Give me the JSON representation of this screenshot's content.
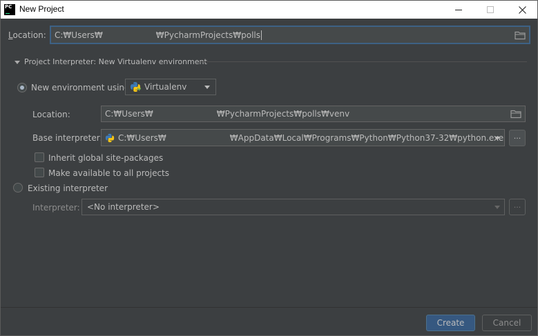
{
  "window": {
    "title": "New Project",
    "app_icon_text": "PC"
  },
  "location": {
    "label_prefix": "",
    "label_mnemonic": "L",
    "label_rest": "ocation:",
    "value_start": "C:₩Users₩",
    "value_end": "₩PycharmProjects₩polls"
  },
  "interpreter_section": {
    "title": "Project Interpreter: New Virtualenv environment"
  },
  "new_env": {
    "label": "New environment using",
    "tool": "Virtualenv",
    "location_label": "Location:",
    "location_start": "C:₩Users₩",
    "location_end": "₩PycharmProjects₩polls₩venv",
    "base_label": "Base interpreter:",
    "base_start": "C:₩Users₩",
    "base_end": "₩AppData₩Local₩Programs₩Python₩Python37-32₩python.exe",
    "browse_label": "...",
    "inherit_label": "Inherit global site-packages",
    "available_label": "Make available to all projects"
  },
  "existing": {
    "label": "Existing interpreter",
    "interpreter_label": "Interpreter:",
    "interpreter_value": "<No interpreter>",
    "browse_label": "..."
  },
  "buttons": {
    "create": "Create",
    "cancel": "Cancel"
  },
  "colors": {
    "background": "#3c3f41",
    "accent": "#365880",
    "focus_border": "#3d6185"
  }
}
